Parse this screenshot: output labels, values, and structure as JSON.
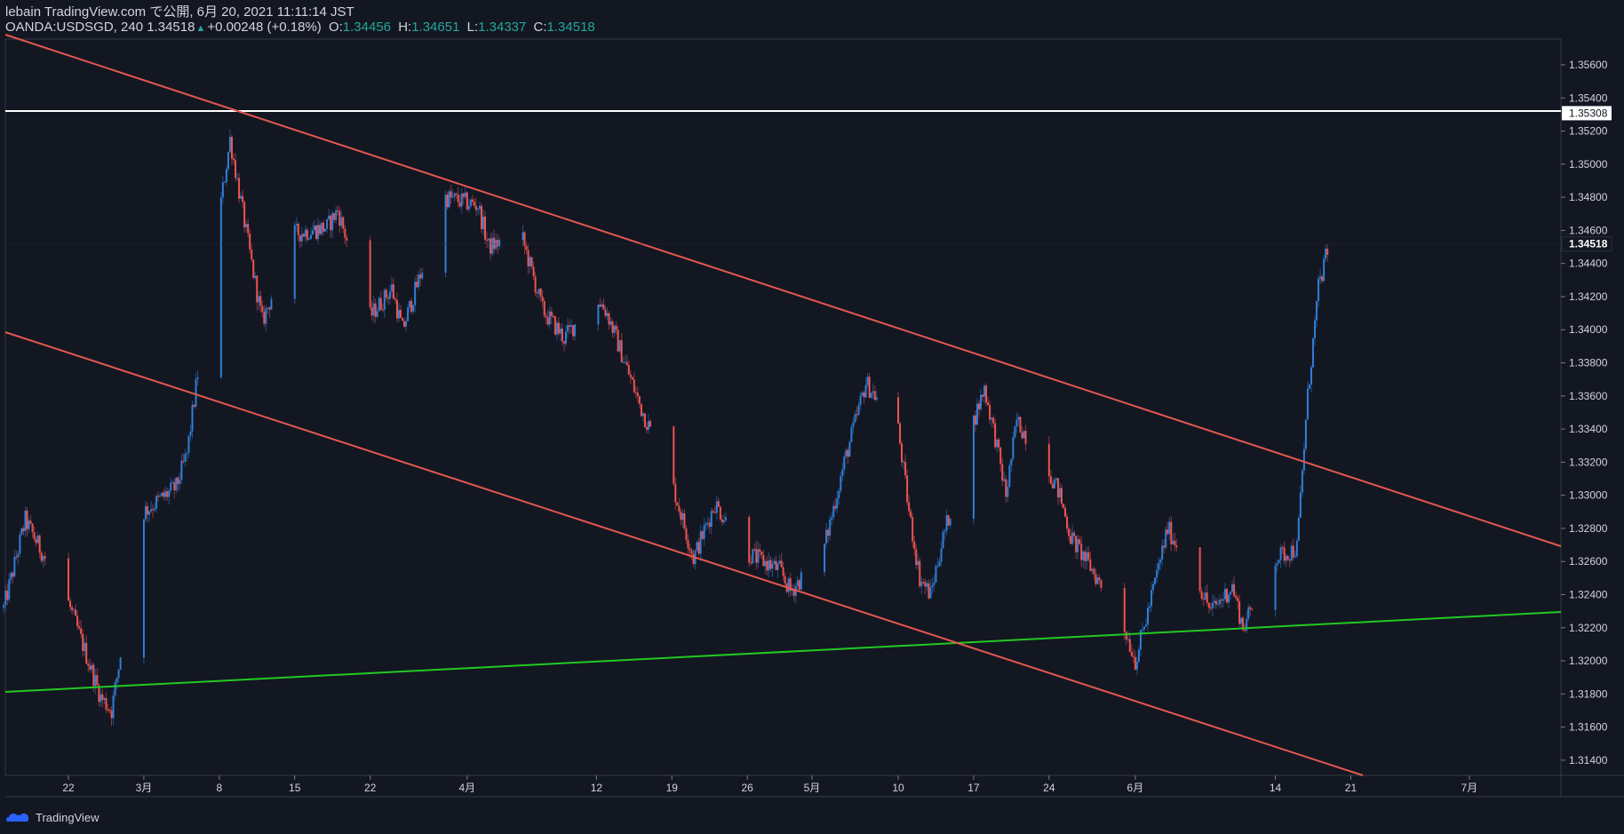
{
  "header": {
    "line1": "lebain TradingView.com で公開, 6月 20, 2021 11:11:14 JST",
    "symbol": "OANDA:USDSGD, 240",
    "last": "1.34518",
    "change": "+0.00248 (+0.18%)",
    "o_label": "O:",
    "o_value": "1.34456",
    "h_label": "H:",
    "h_value": "1.34651",
    "l_label": "L:",
    "l_value": "1.34337",
    "c_label": "C:",
    "c_value": "1.34518"
  },
  "footer": {
    "brand": "TradingView"
  },
  "colors": {
    "background": "#131722",
    "up": "#2e7fd9",
    "down": "#ef5350",
    "channel": "#e4574f",
    "support": "#22c922",
    "resistance": "#ffffff"
  },
  "chart_data": {
    "type": "candlestick",
    "symbol": "OANDA:USDSGD",
    "timeframe": "240",
    "y_ticks": [
      "1.35600",
      "1.35400",
      "1.35200",
      "1.35000",
      "1.34800",
      "1.34600",
      "1.34400",
      "1.34200",
      "1.34000",
      "1.33800",
      "1.33600",
      "1.33400",
      "1.33200",
      "1.33000",
      "1.32800",
      "1.32600",
      "1.32400",
      "1.32200",
      "1.32000",
      "1.31800",
      "1.31600",
      "1.31400"
    ],
    "x_labels": [
      "22",
      "3月",
      "8",
      "15",
      "22",
      "4月",
      "12",
      "19",
      "26",
      "5月",
      "10",
      "17",
      "24",
      "6月",
      "14",
      "21",
      "7月"
    ],
    "price_labels": {
      "horizontal_line": "1.35308",
      "last_price": "1.34518"
    },
    "horizontal_line": 1.35308,
    "last_price": 1.34518,
    "key_points": [
      {
        "date": "2021-02-16",
        "close": 1.3232
      },
      {
        "date": "2021-02-18",
        "close": 1.3285
      },
      {
        "date": "2021-02-22",
        "close": 1.3235
      },
      {
        "date": "2021-02-25",
        "close": 1.3178
      },
      {
        "date": "2021-02-26",
        "close": 1.317
      },
      {
        "date": "2021-03-01",
        "close": 1.329
      },
      {
        "date": "2021-03-04",
        "close": 1.3305
      },
      {
        "date": "2021-03-05",
        "close": 1.3325
      },
      {
        "date": "2021-03-08",
        "close": 1.347
      },
      {
        "date": "2021-03-09",
        "close": 1.3515
      },
      {
        "date": "2021-03-11",
        "close": 1.344
      },
      {
        "date": "2021-03-12",
        "close": 1.3405
      },
      {
        "date": "2021-03-15",
        "close": 1.3458
      },
      {
        "date": "2021-03-18",
        "close": 1.3462
      },
      {
        "date": "2021-03-19",
        "close": 1.3472
      },
      {
        "date": "2021-03-22",
        "close": 1.3408
      },
      {
        "date": "2021-03-24",
        "close": 1.3425
      },
      {
        "date": "2021-03-25",
        "close": 1.34
      },
      {
        "date": "2021-03-29",
        "close": 1.348
      },
      {
        "date": "2021-04-01",
        "close": 1.3475
      },
      {
        "date": "2021-04-02",
        "close": 1.345
      },
      {
        "date": "2021-04-05",
        "close": 1.3458
      },
      {
        "date": "2021-04-07",
        "close": 1.3412
      },
      {
        "date": "2021-04-09",
        "close": 1.3395
      },
      {
        "date": "2021-04-12",
        "close": 1.342
      },
      {
        "date": "2021-04-13",
        "close": 1.341
      },
      {
        "date": "2021-04-16",
        "close": 1.3355
      },
      {
        "date": "2021-04-19",
        "close": 1.3308
      },
      {
        "date": "2021-04-21",
        "close": 1.3262
      },
      {
        "date": "2021-04-23",
        "close": 1.3295
      },
      {
        "date": "2021-04-26",
        "close": 1.3265
      },
      {
        "date": "2021-04-29",
        "close": 1.3255
      },
      {
        "date": "2021-04-30",
        "close": 1.3242
      },
      {
        "date": "2021-05-03",
        "close": 1.3265
      },
      {
        "date": "2021-05-05",
        "close": 1.332
      },
      {
        "date": "2021-05-07",
        "close": 1.3368
      },
      {
        "date": "2021-05-10",
        "close": 1.334
      },
      {
        "date": "2021-05-11",
        "close": 1.329
      },
      {
        "date": "2021-05-12",
        "close": 1.325
      },
      {
        "date": "2021-05-13",
        "close": 1.324
      },
      {
        "date": "2021-05-14",
        "close": 1.327
      },
      {
        "date": "2021-05-17",
        "close": 1.3345
      },
      {
        "date": "2021-05-18",
        "close": 1.3365
      },
      {
        "date": "2021-05-19",
        "close": 1.3335
      },
      {
        "date": "2021-05-20",
        "close": 1.33
      },
      {
        "date": "2021-05-21",
        "close": 1.3345
      },
      {
        "date": "2021-05-24",
        "close": 1.3315
      },
      {
        "date": "2021-05-25",
        "close": 1.33
      },
      {
        "date": "2021-05-26",
        "close": 1.3275
      },
      {
        "date": "2021-05-28",
        "close": 1.3255
      },
      {
        "date": "2021-05-31",
        "close": 1.322
      },
      {
        "date": "2021-06-01",
        "close": 1.32
      },
      {
        "date": "2021-06-02",
        "close": 1.3225
      },
      {
        "date": "2021-06-04",
        "close": 1.328
      },
      {
        "date": "2021-06-07",
        "close": 1.3245
      },
      {
        "date": "2021-06-08",
        "close": 1.323
      },
      {
        "date": "2021-06-10",
        "close": 1.3245
      },
      {
        "date": "2021-06-11",
        "close": 1.322
      },
      {
        "date": "2021-06-14",
        "close": 1.3262
      },
      {
        "date": "2021-06-16",
        "close": 1.3268
      },
      {
        "date": "2021-06-17",
        "close": 1.336
      },
      {
        "date": "2021-06-18",
        "close": 1.3425
      },
      {
        "date": "2021-06-19",
        "close": 1.3452
      }
    ]
  }
}
